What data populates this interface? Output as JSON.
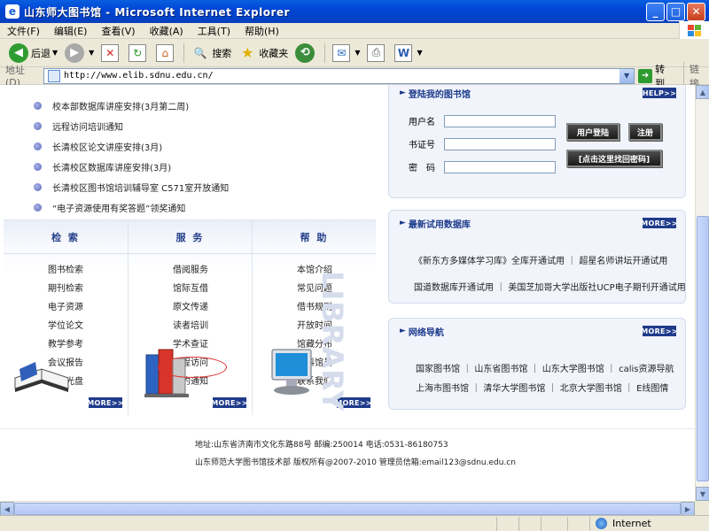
{
  "window": {
    "title": "山东师大图书馆 - Microsoft Internet Explorer",
    "minimize": "_",
    "maximize": "□",
    "close": "✕"
  },
  "menu": [
    "文件(F)",
    "编辑(E)",
    "查看(V)",
    "收藏(A)",
    "工具(T)",
    "帮助(H)"
  ],
  "toolbar": {
    "back": "后退",
    "search": "搜索",
    "favorites": "收藏夹"
  },
  "address": {
    "label": "地址(D)",
    "url": "http://www.elib.sdnu.edu.cn/",
    "go": "转到",
    "links": "链接"
  },
  "news": [
    "校本部数据库讲座安排(3月第二周)",
    "远程访问培训通知",
    "长清校区论文讲座安排(3月)",
    "长清校区数据库讲座安排(3月)",
    "长清校区图书馆培训辅导室 C571室开放通知",
    "“电子资源使用有奖答题”领奖通知"
  ],
  "categories": [
    {
      "title": "检 索",
      "links": [
        "图书检索",
        "期刊检索",
        "电子资源",
        "学位论文",
        "教学参考",
        "会议报告",
        "随书光盘"
      ]
    },
    {
      "title": "服 务",
      "links": [
        "借阅服务",
        "馆际互借",
        "原文传递",
        "读者培训",
        "学术查证",
        "远程访问",
        "预约通知"
      ]
    },
    {
      "title": "帮 助",
      "links": [
        "本馆介绍",
        "常见问题",
        "借书规则",
        "开放时间",
        "馆藏分布",
        "学科馆员",
        "联系我们"
      ]
    }
  ],
  "more_label": "MORE>>",
  "help_label": "HELP>>",
  "watermark": "LIBRARY",
  "login": {
    "title": "登陆我的图书馆",
    "username_label": "用户名",
    "card_label": "书证号",
    "password_label": "密　码",
    "login_btn": "用户登陆",
    "register_btn": "注册",
    "recover_btn": "[点击这里找回密码]"
  },
  "trial_db": {
    "title": "最新试用数据库",
    "lines": [
      "《新东方多媒体学习库》全库开通试用 ｜ 超星名师讲坛开通试用",
      "国道数据库开通试用 ｜ 美国芝加哥大学出版社UCP电子期刊开通试用"
    ]
  },
  "web_nav": {
    "title": "网络导航",
    "lines": [
      "国家图书馆 ｜ 山东省图书馆 ｜ 山东大学图书馆 ｜ calis资源导航",
      "上海市图书馆 ｜ 清华大学图书馆 ｜ 北京大学图书馆 ｜ E线图情"
    ]
  },
  "footer": {
    "address": "地址:山东省济南市文化东路88号 邮编:250014   电话:0531-86180753",
    "copyright": "山东师范大学图书馆技术部 版权所有@2007-2010 管理员信箱:email123@sdnu.edu.cn"
  },
  "status": {
    "zone": "Internet"
  },
  "colors": {
    "titlebar": "#0046d5",
    "heading_blue": "#1c3a8c",
    "more_button": "#1f3b8a",
    "highlight_ellipse": "#e03030"
  }
}
